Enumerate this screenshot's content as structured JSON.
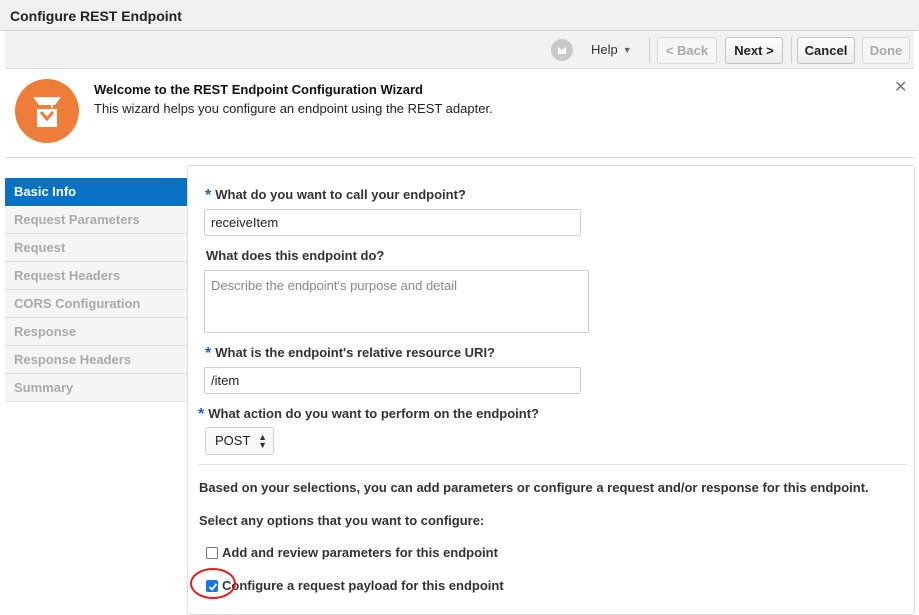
{
  "window": {
    "title": "Configure REST Endpoint"
  },
  "toolbar": {
    "help_label": "Help",
    "back_label": "< Back",
    "next_label": "Next >",
    "cancel_label": "Cancel",
    "done_label": "Done"
  },
  "welcome": {
    "heading": "Welcome to the REST Endpoint Configuration Wizard",
    "description": "This wizard helps you configure an endpoint using the REST adapter."
  },
  "nav": {
    "items": [
      {
        "label": "Basic Info",
        "active": true
      },
      {
        "label": "Request Parameters",
        "active": false
      },
      {
        "label": "Request",
        "active": false
      },
      {
        "label": "Request Headers",
        "active": false
      },
      {
        "label": "CORS Configuration",
        "active": false
      },
      {
        "label": "Response",
        "active": false
      },
      {
        "label": "Response Headers",
        "active": false
      },
      {
        "label": "Summary",
        "active": false
      }
    ]
  },
  "form": {
    "required_marker": "*",
    "name_question": "What do you want to call your endpoint?",
    "name_value": "receiveItem",
    "purpose_question": "What does this endpoint do?",
    "purpose_placeholder": "Describe the endpoint's purpose and detail",
    "uri_question": "What is the endpoint's relative resource URI?",
    "uri_value": "/item",
    "action_question": "What action do you want to perform on the endpoint?",
    "action_value": "POST",
    "info_text": "Based on your selections, you can add parameters or configure a request and/or response for this endpoint.",
    "options_prompt": "Select any options that you want to configure:",
    "option_params_label": "Add and review parameters for this endpoint",
    "option_params_checked": false,
    "option_request_label": "Configure a request payload for this endpoint",
    "option_request_checked": true
  },
  "colors": {
    "accent": "#0a72c4",
    "logo": "#ef7d3a",
    "annotation": "#e0201b"
  }
}
